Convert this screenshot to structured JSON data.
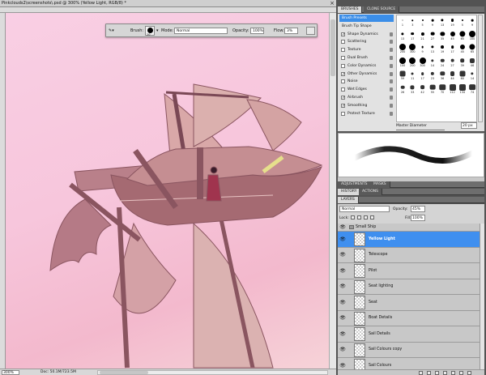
{
  "document": {
    "title": "Pinkclouds2\\screenshots\\.psd @ 300% (Yellow Light, RGB/8) *",
    "zoom": "300%",
    "doc_info": "Doc: 50.1M/723.5M"
  },
  "options_bar": {
    "brush_label": "Brush:",
    "brush_size": "20",
    "mode_label": "Mode:",
    "mode_value": "Normal",
    "opacity_label": "Opacity:",
    "opacity_value": "100%",
    "flow_label": "Flow:",
    "flow_value": "3%"
  },
  "brushes_panel": {
    "tabs": [
      "BRUSHES",
      "CLONE SOURCE"
    ],
    "list": [
      {
        "label": "Brush Presets",
        "checkbox": false,
        "checked": false,
        "lock": false,
        "selected": true
      },
      {
        "label": "Brush Tip Shape",
        "checkbox": false,
        "checked": false,
        "lock": false,
        "selected": false
      },
      {
        "label": "Shape Dynamics",
        "checkbox": true,
        "checked": true,
        "lock": true,
        "selected": false
      },
      {
        "label": "Scattering",
        "checkbox": true,
        "checked": false,
        "lock": true,
        "selected": false
      },
      {
        "label": "Texture",
        "checkbox": true,
        "checked": false,
        "lock": true,
        "selected": false
      },
      {
        "label": "Dual Brush",
        "checkbox": true,
        "checked": false,
        "lock": true,
        "selected": false
      },
      {
        "label": "Color Dynamics",
        "checkbox": true,
        "checked": false,
        "lock": true,
        "selected": false
      },
      {
        "label": "Other Dynamics",
        "checkbox": true,
        "checked": true,
        "lock": true,
        "selected": false
      },
      {
        "label": "Noise",
        "checkbox": true,
        "checked": false,
        "lock": true,
        "selected": false
      },
      {
        "label": "Wet Edges",
        "checkbox": true,
        "checked": false,
        "lock": true,
        "selected": false
      },
      {
        "label": "Airbrush",
        "checkbox": true,
        "checked": true,
        "lock": true,
        "selected": false
      },
      {
        "label": "Smoothing",
        "checkbox": true,
        "checked": true,
        "lock": true,
        "selected": false
      },
      {
        "label": "Protect Texture",
        "checkbox": true,
        "checked": false,
        "lock": true,
        "selected": false
      }
    ],
    "presets": [
      "1",
      "3",
      "5",
      "9",
      "13",
      "19",
      "5",
      "9",
      "13",
      "17",
      "21",
      "27",
      "35",
      "45",
      "65",
      "100",
      "200",
      "300",
      "9",
      "13",
      "19",
      "17",
      "45",
      "65",
      "100",
      "200",
      "300",
      "14",
      "24",
      "27",
      "39",
      "46",
      "59",
      "11",
      "17",
      "23",
      "36",
      "44",
      "60",
      "14",
      "26",
      "33",
      "42",
      "55",
      "70",
      "112",
      "134",
      "74"
    ],
    "master_diameter_label": "Master Diameter",
    "master_diameter_value": "20 px"
  },
  "adjust_tabs": [
    "ADJUSTMENTS",
    "MASKS"
  ],
  "history_tabs": [
    "HISTORY",
    "ACTIONS"
  ],
  "layers_panel": {
    "tabs": [
      "LAYERS"
    ],
    "blend_mode": "Normal",
    "opacity_label": "Opacity:",
    "opacity_value": "45%",
    "lock_label": "Lock:",
    "fill_label": "Fill:",
    "fill_value": "100%",
    "layers": [
      {
        "name": "Small Ship",
        "type": "group",
        "selected": false
      },
      {
        "name": "Yellow Light",
        "type": "layer",
        "selected": true
      },
      {
        "name": "Telescope",
        "type": "layer",
        "selected": false
      },
      {
        "name": "Pilot",
        "type": "layer",
        "selected": false
      },
      {
        "name": "Seat lighting",
        "type": "layer",
        "selected": false
      },
      {
        "name": "Seat",
        "type": "layer",
        "selected": false
      },
      {
        "name": "Boat Details",
        "type": "layer",
        "selected": false
      },
      {
        "name": "Sail Details",
        "type": "layer",
        "selected": false
      },
      {
        "name": "Sail Colours copy",
        "type": "layer",
        "selected": false
      },
      {
        "name": "Sail Colours",
        "type": "layer",
        "selected": false
      }
    ]
  },
  "colors": {
    "selection": "#3f8fef",
    "canvas_pink": "#f7c6dc",
    "ship_brown": "#a56a72"
  }
}
